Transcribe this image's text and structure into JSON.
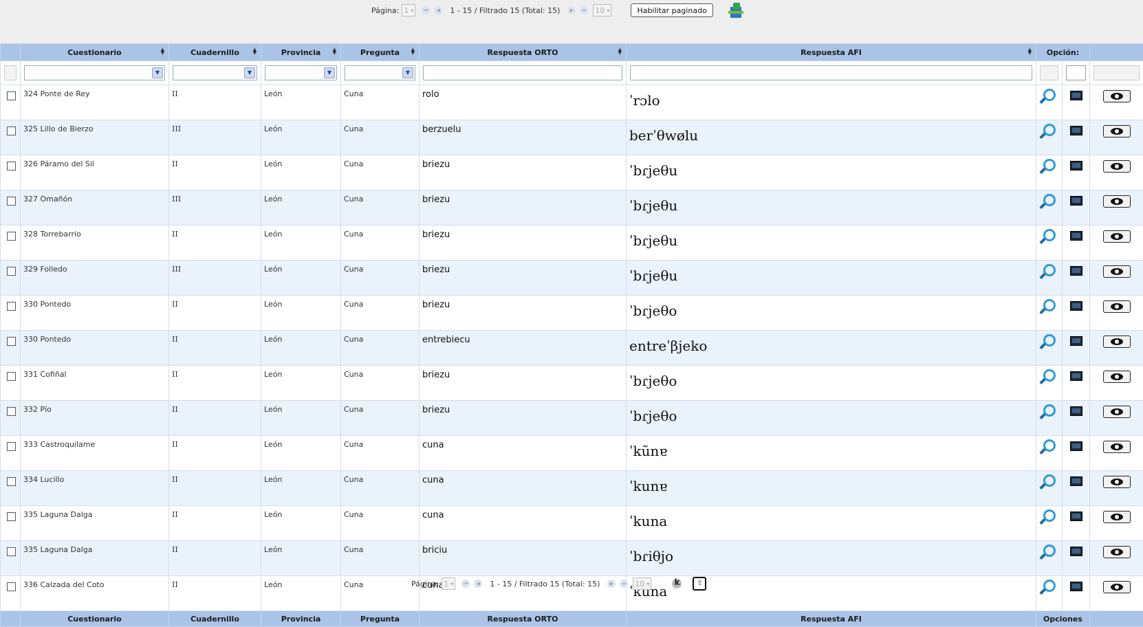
{
  "pager": {
    "pagina_label": "Página:",
    "page_value": "1",
    "range_text": "1 - 15 / Filtrado 15 (Total: 15)",
    "rows_value": "10",
    "enable_button": "Habilitar paginado"
  },
  "columns": {
    "cuestionario": "Cuestionario",
    "cuadernillo": "Cuadernillo",
    "provincia": "Provincia",
    "pregunta": "Pregunta",
    "orto": "Respuesta ORTO",
    "afi": "Respuesta AFI",
    "opcion": "Opción:",
    "opciones": "Opciones"
  },
  "rows": [
    {
      "cuestionario": "324 Ponte de Rey",
      "cuadernillo": "II",
      "provincia": "León",
      "pregunta": "Cuna",
      "orto": "rolo",
      "afi": "ˈrɔlo"
    },
    {
      "cuestionario": "325 Lillo de Bierzo",
      "cuadernillo": "III",
      "provincia": "León",
      "pregunta": "Cuna",
      "orto": "berzuelu",
      "afi": "berˈθwølu"
    },
    {
      "cuestionario": "326 Páramo del Sil",
      "cuadernillo": "II",
      "provincia": "León",
      "pregunta": "Cuna",
      "orto": "briezu",
      "afi": "ˈbɾjeθu"
    },
    {
      "cuestionario": "327 Omañón",
      "cuadernillo": "III",
      "provincia": "León",
      "pregunta": "Cuna",
      "orto": "briezu",
      "afi": "ˈbɾjeθu"
    },
    {
      "cuestionario": "328 Torrebarrio",
      "cuadernillo": "II",
      "provincia": "León",
      "pregunta": "Cuna",
      "orto": "briezu",
      "afi": "ˈbɾjeθu"
    },
    {
      "cuestionario": "329 Folledo",
      "cuadernillo": "III",
      "provincia": "León",
      "pregunta": "Cuna",
      "orto": "briezu",
      "afi": "ˈbɾjeθu"
    },
    {
      "cuestionario": "330 Pontedo",
      "cuadernillo": "II",
      "provincia": "León",
      "pregunta": "Cuna",
      "orto": "briezu",
      "afi": "ˈbɾjeθo"
    },
    {
      "cuestionario": "330 Pontedo",
      "cuadernillo": "II",
      "provincia": "León",
      "pregunta": "Cuna",
      "orto": "entrebiecu",
      "afi": "entreˈβjeko"
    },
    {
      "cuestionario": "331 Cofiñal",
      "cuadernillo": "II",
      "provincia": "León",
      "pregunta": "Cuna",
      "orto": "briezu",
      "afi": "ˈbɾjeθo"
    },
    {
      "cuestionario": "332 Pío",
      "cuadernillo": "II",
      "provincia": "León",
      "pregunta": "Cuna",
      "orto": "briezu",
      "afi": "ˈbɾjeθo"
    },
    {
      "cuestionario": "333 Castroquilame",
      "cuadernillo": "II",
      "provincia": "León",
      "pregunta": "Cuna",
      "orto": "cuna",
      "afi": "ˈkũnɐ"
    },
    {
      "cuestionario": "334 Lucillo",
      "cuadernillo": "II",
      "provincia": "León",
      "pregunta": "Cuna",
      "orto": "cuna",
      "afi": "ˈkunɐ"
    },
    {
      "cuestionario": "335 Laguna Dalga",
      "cuadernillo": "II",
      "provincia": "León",
      "pregunta": "Cuna",
      "orto": "cuna",
      "afi": "ˈkuna"
    },
    {
      "cuestionario": "335 Laguna Dalga",
      "cuadernillo": "II",
      "provincia": "León",
      "pregunta": "Cuna",
      "orto": "briciu",
      "afi": "ˈbɾiθjo"
    },
    {
      "cuestionario": "336 Calzada del Coto",
      "cuadernillo": "II",
      "provincia": "León",
      "pregunta": "Cuna",
      "orto": "cuna",
      "afi": "ˈkuna"
    }
  ],
  "icons": {
    "view": "magnifier-icon",
    "media": "monitor-icon",
    "eye": "eye-icon",
    "export": "export-icon",
    "reset": "k-icon",
    "upload": "upload-icon"
  }
}
